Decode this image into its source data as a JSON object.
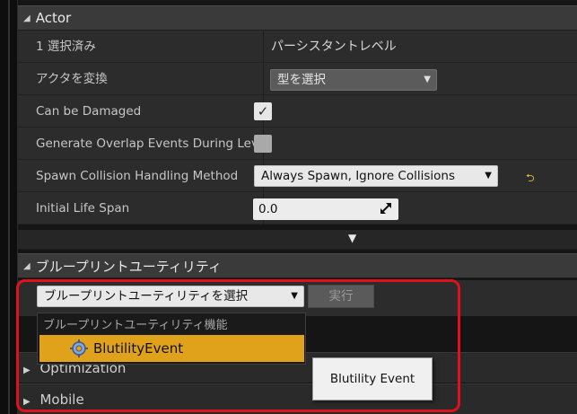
{
  "actor": {
    "header": "Actor",
    "rows": [
      {
        "label": "1 選択済み",
        "value": "パーシスタントレベル"
      },
      {
        "label": "アクタを変換",
        "value": "型を選択"
      },
      {
        "label": "Can be Damaged",
        "checked": true
      },
      {
        "label": "Generate Overlap Events During Level Streaming",
        "checked": false
      },
      {
        "label": "Spawn Collision Handling Method",
        "value": "Always Spawn, Ignore Collisions"
      },
      {
        "label": "Initial Life Span",
        "value": "0.0"
      }
    ]
  },
  "blueprint_utility": {
    "header": "ブループリントユーティリティ",
    "select_value": "ブループリントユーティリティを選択",
    "exec_label": "実行",
    "dropdown_header": "ブループリントユーティリティ機能",
    "dropdown_item": "BlutilityEvent"
  },
  "behind_sections": [
    "Optimization",
    "Mobile"
  ],
  "tooltip": "Blutility Event",
  "colors": {
    "highlight": "#e0111b",
    "selected_item": "#e0a21a",
    "reset_arrow": "#e8c236"
  }
}
